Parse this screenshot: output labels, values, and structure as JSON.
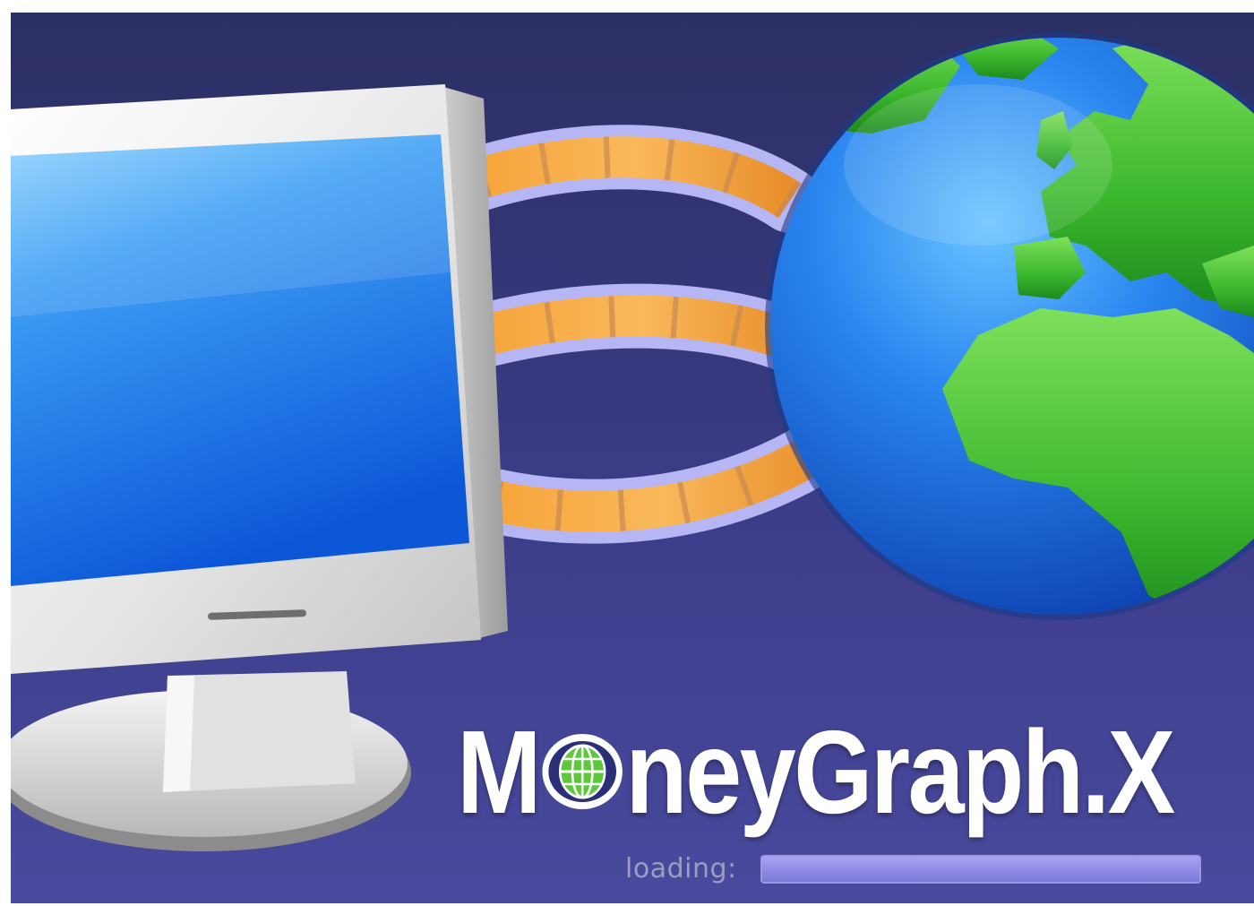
{
  "app": {
    "logo_parts": {
      "before": "M",
      "after": "neyGraph.X"
    }
  },
  "loading": {
    "label": "loading:",
    "progress": 1.0
  },
  "icons": {
    "monitor": "computer-monitor-icon",
    "globe": "globe-icon",
    "connection": "data-cable-icon",
    "logo_o": "eye-globe-icon"
  },
  "colors": {
    "background": "#35387a",
    "screen_blue": "#2f8ff0",
    "cable_orange": "#f3a445",
    "globe_ocean": "#1a6fe0",
    "land_green": "#4fc23a",
    "progress_fill": "#8e8ae6"
  }
}
